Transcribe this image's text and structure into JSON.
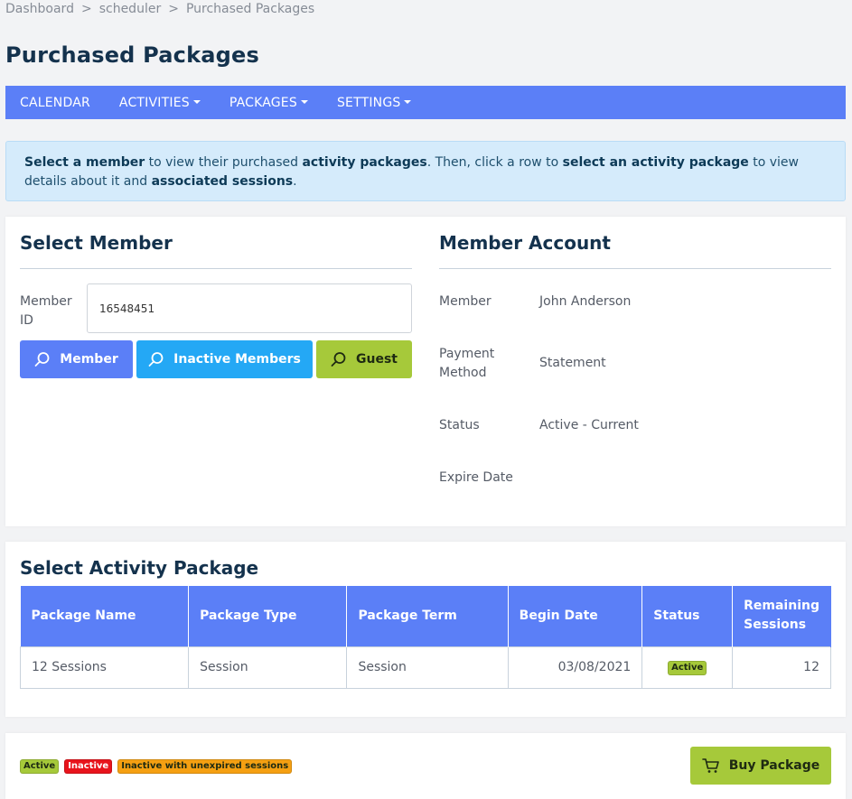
{
  "breadcrumb": {
    "items": [
      "Dashboard",
      "scheduler",
      "Purchased Packages"
    ],
    "separator": ">"
  },
  "page": {
    "title": "Purchased Packages"
  },
  "nav": {
    "calendar": "CALENDAR",
    "activities": "ACTIVITIES",
    "packages": "PACKAGES",
    "settings": "SETTINGS"
  },
  "info": {
    "p1": "Select a member",
    "p2": " to view their purchased ",
    "p3": "activity packages",
    "p4": ". Then, click a row to ",
    "p5": "select an activity package",
    "p6": " to view details about it and ",
    "p7": "associated sessions",
    "p8": "."
  },
  "select_member": {
    "title": "Select Member",
    "member_id_label": "Member ID",
    "member_id_value": "16548451",
    "btn_member": "Member",
    "btn_inactive": "Inactive Members",
    "btn_guest": "Guest"
  },
  "member_account": {
    "title": "Member Account",
    "member_label": "Member",
    "member_value": "John Anderson",
    "payment_label": "Payment Method",
    "payment_value": "Statement",
    "status_label": "Status",
    "status_value": "Active - Current",
    "expire_label": "Expire Date",
    "expire_value": ""
  },
  "packages": {
    "title": "Select Activity Package",
    "columns": [
      "Package Name",
      "Package Type",
      "Package Term",
      "Begin Date",
      "Status",
      "Remaining Sessions"
    ],
    "rows": [
      {
        "name": "12 Sessions",
        "type": "Session",
        "term": "Session",
        "begin": "03/08/2021",
        "status": "Active",
        "remaining": "12"
      }
    ]
  },
  "legend": {
    "active": "Active",
    "inactive": "Inactive",
    "unexpired": "Inactive with unexpired sessions"
  },
  "footer": {
    "buy_label": "Buy Package"
  },
  "colors": {
    "nav_bg": "#5b7ff7",
    "member_btn": "#5b7ff7",
    "inactive_btn": "#24a8f5",
    "guest_btn": "#a6c93a",
    "badge_active": "#a6c93a",
    "badge_inactive": "#e8141c",
    "badge_unexpired": "#f5a012",
    "title": "#14324d"
  }
}
